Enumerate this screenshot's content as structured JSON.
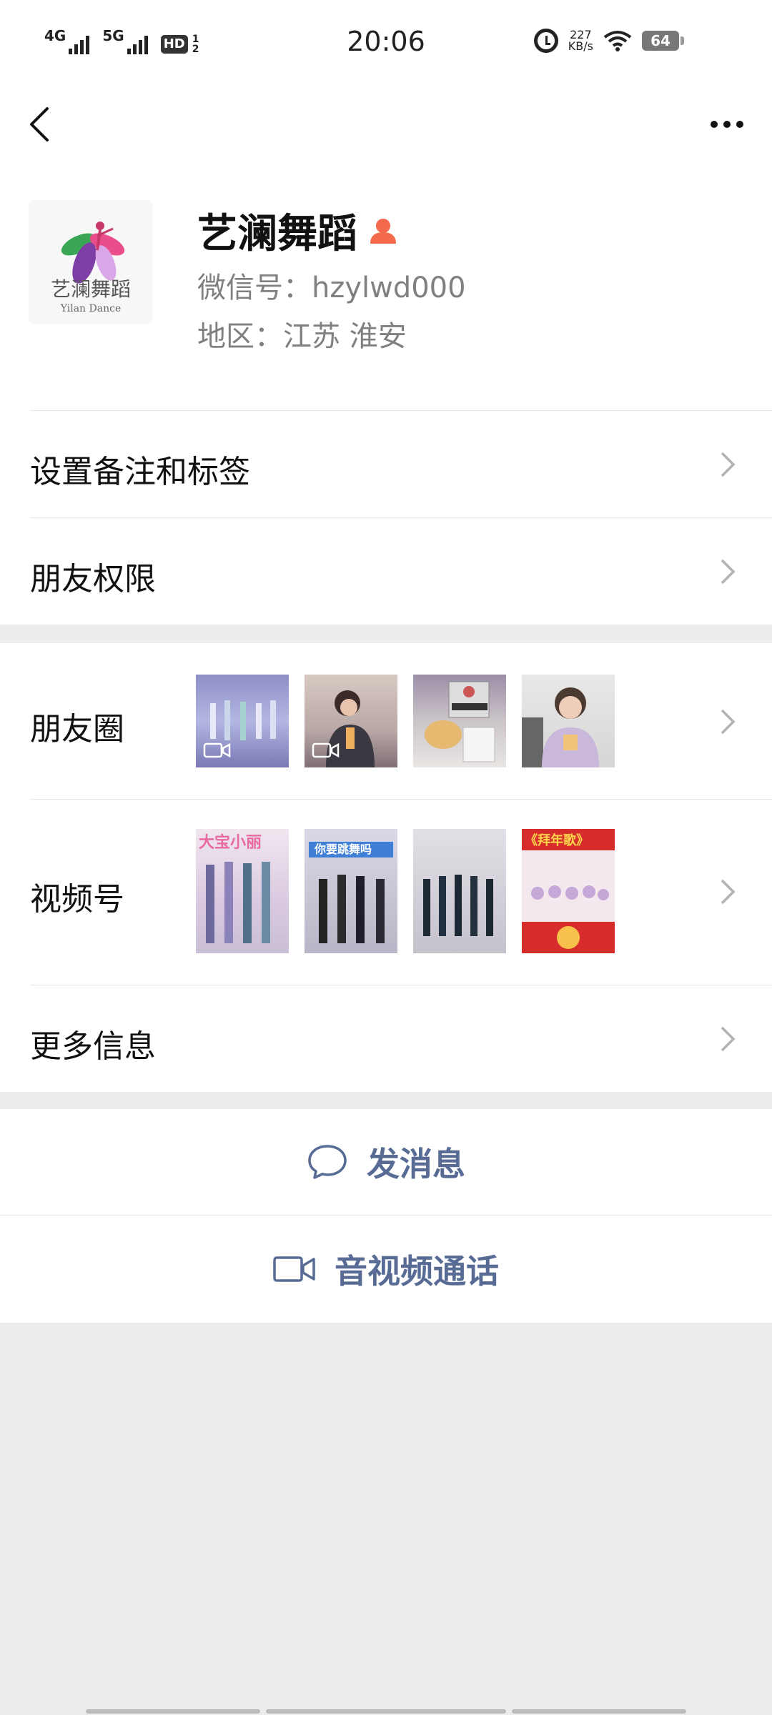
{
  "status_bar": {
    "net1": "4G",
    "net2": "5G",
    "hd": "HD",
    "hd_sub_top": "1",
    "hd_sub_bottom": "2",
    "time": "20:06",
    "speed_value": "227",
    "speed_unit": "KB/s",
    "battery": "64"
  },
  "nav": {
    "back_icon": "chevron-left-icon",
    "more_icon": "ellipsis-icon"
  },
  "profile": {
    "name": "艺澜舞蹈",
    "wechat_id": "微信号：hzylwd000",
    "region": "地区：江苏  淮安",
    "avatar_text": "艺澜舞蹈",
    "avatar_subtext": "Yilan Dance"
  },
  "rows": {
    "remark": "设置备注和标签",
    "permissions": "朋友权限",
    "moments": "朋友圈",
    "channels": "视频号",
    "more_info": "更多信息"
  },
  "channels_thumb_texts": [
    "大宝小丽",
    "你要跳舞吗",
    "",
    "《拜年歌》"
  ],
  "actions": {
    "message": "发消息",
    "video_call": "音视频通话"
  },
  "colors": {
    "link_blue": "#576b95",
    "background": "#ededed",
    "verified_orange": "#f26a4b"
  }
}
